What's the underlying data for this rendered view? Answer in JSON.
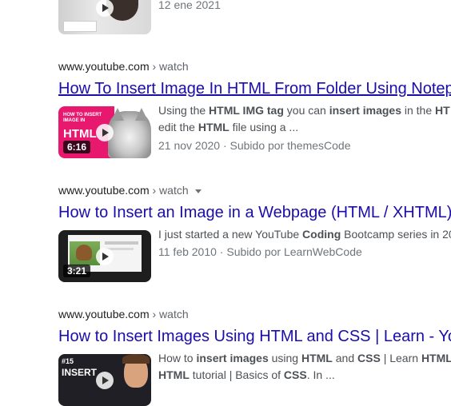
{
  "top_partial": {
    "date": "12 ene 2021"
  },
  "results": [
    {
      "cite_domain": "www.youtube.com",
      "cite_path": " › watch",
      "title": "How To Insert Image In HTML From Folder Using Notep",
      "snippet_line1": [
        "Using the ",
        "HTML IMG tag",
        " you can ",
        "insert images",
        " in the ",
        "HT"
      ],
      "snippet_line2": [
        "edit the ",
        "HTML",
        " file using a ..."
      ],
      "date_line": "21 nov 2020 · Subido por themesCode",
      "duration": "6:16",
      "thumb_text": [
        "HOW TO INSERT",
        "IMAGE IN",
        "HTML"
      ]
    },
    {
      "cite_domain": "www.youtube.com",
      "cite_path": " › watch",
      "title": "How to Insert an Image in a Webpage (HTML / XHTML)",
      "snippet_line1": [
        "I just started a new YouTube ",
        "Coding",
        " Bootcamp series in 20"
      ],
      "date_line": "11 feb 2010 · Subido por LearnWebCode",
      "duration": "3:21"
    },
    {
      "cite_domain": "www.youtube.com",
      "cite_path": " › watch",
      "title": "How to Insert Images Using HTML and CSS | Learn - Yo",
      "snippet_line1": [
        "How to ",
        "insert images",
        " using ",
        "HTML",
        " and ",
        "CSS",
        " | Learn ",
        "HTML"
      ],
      "snippet_line2": [
        "HTML",
        " tutorial | Basics of ",
        "CSS",
        ". In ..."
      ],
      "thumb_text": [
        "#15",
        "INSERT"
      ]
    }
  ],
  "colors": {
    "link": "#1a0dab",
    "text": "#4d5156",
    "meta": "#70757a"
  }
}
